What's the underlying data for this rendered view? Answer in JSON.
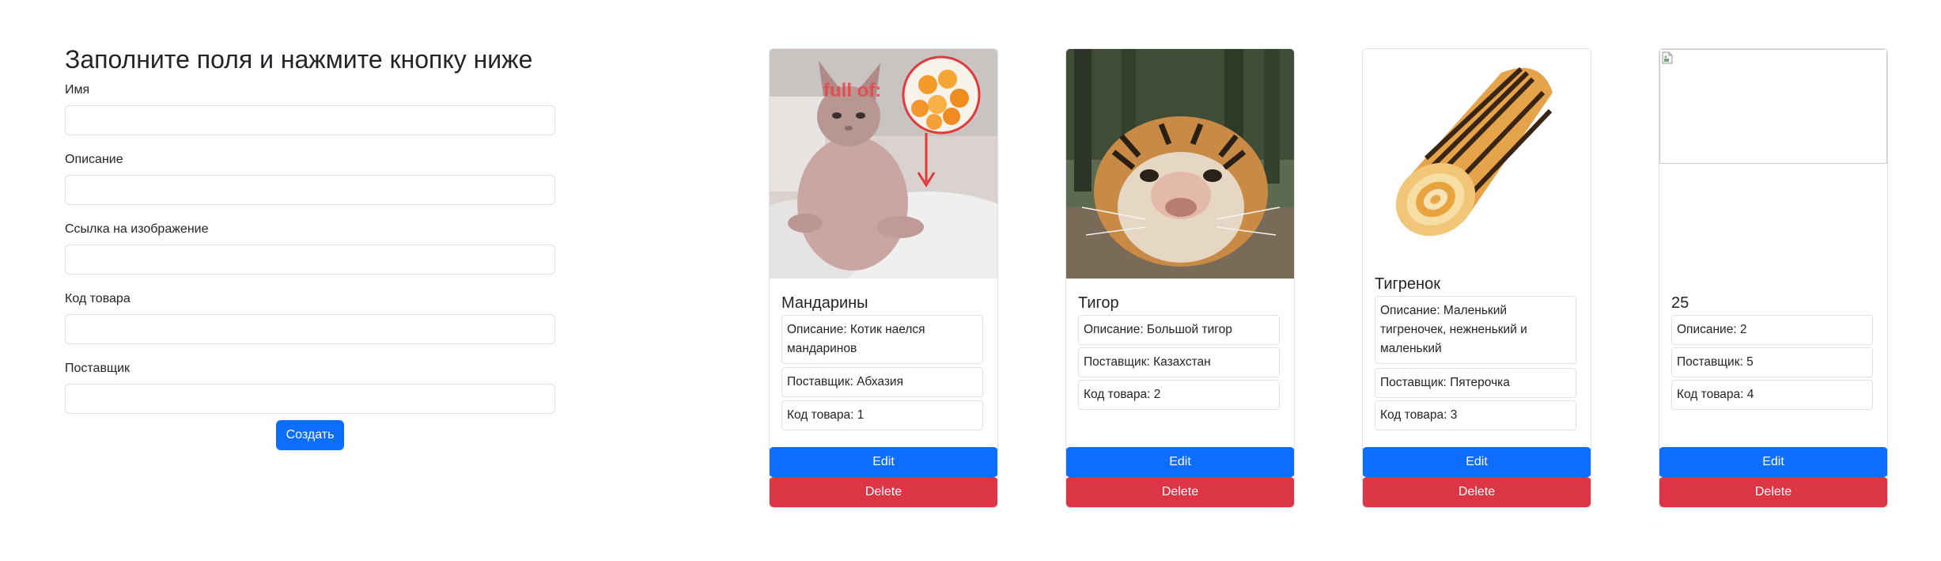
{
  "form": {
    "title": "Заполните поля и нажмите кнопку ниже",
    "fields": [
      {
        "label": "Имя",
        "value": "",
        "placeholder": ""
      },
      {
        "label": "Описание",
        "value": "",
        "placeholder": ""
      },
      {
        "label": "Ссылка на изображение",
        "value": "",
        "placeholder": ""
      },
      {
        "label": "Код товара",
        "value": "",
        "placeholder": ""
      },
      {
        "label": "Поставщик",
        "value": "",
        "placeholder": ""
      }
    ],
    "submit_label": "Создать"
  },
  "cards": [
    {
      "title": "Мандарины",
      "image_text": "full of:",
      "description": "Описание: Котик наелся мандаринов",
      "supplier": "Поставщик: Абхазия",
      "code": "Код товара: 1",
      "edit_label": "Edit",
      "delete_label": "Delete"
    },
    {
      "title": "Тигор",
      "description": "Описание: Большой тигор",
      "supplier": "Поставщик: Казахстан",
      "code": "Код товара: 2",
      "edit_label": "Edit",
      "delete_label": "Delete"
    },
    {
      "title": "Тигренок",
      "description": "Описание: Маленький тигреночек, нежненький и маленький",
      "supplier": "Поставщик: Пятерочка",
      "code": "Код товара: 3",
      "edit_label": "Edit",
      "delete_label": "Delete"
    },
    {
      "title": "25",
      "description": "Описание: 2",
      "supplier": "Поставщик: 5",
      "code": "Код товара: 4",
      "edit_label": "Edit",
      "delete_label": "Delete"
    }
  ],
  "colors": {
    "primary": "#0d6efd",
    "danger": "#dc3545",
    "border": "#dee2e6",
    "text": "#212529"
  },
  "icons": {
    "broken_image": "broken-image-icon"
  }
}
